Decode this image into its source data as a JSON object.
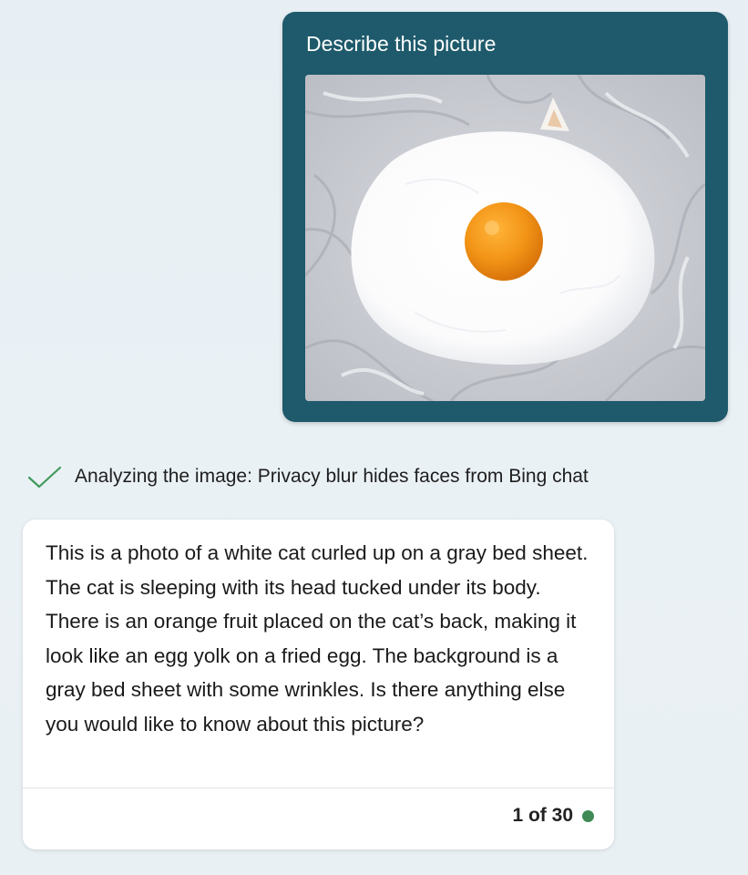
{
  "user_message": {
    "text": "Describe this picture",
    "image_name": "cat-egg-photo"
  },
  "status": {
    "icon": "check-icon",
    "text": "Analyzing the image: Privacy blur hides faces from Bing chat",
    "icon_color": "#3f9a5a"
  },
  "bot_response": {
    "text": "This is a photo of a white cat curled up on a gray bed sheet. The cat is sleeping with its head tucked under its body. There is an orange fruit placed on the cat’s back, making it look like an egg yolk on a fried egg. The background is a gray bed sheet with some wrinkles. Is there anything else you would like to know about this picture?",
    "counter": "1 of 30",
    "counter_dot_color": "#3f8a55"
  },
  "colors": {
    "user_bubble": "#1e5a6b",
    "page_background": "#e8f0f4",
    "card_background": "#ffffff"
  }
}
